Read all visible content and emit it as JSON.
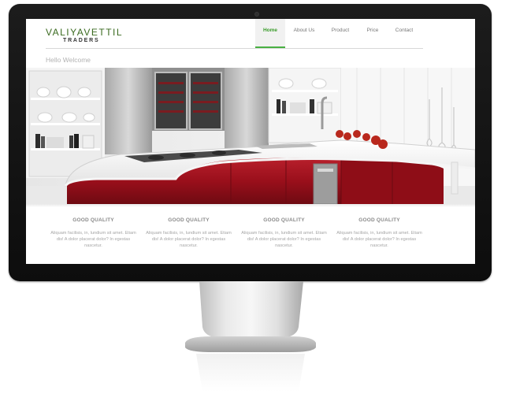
{
  "brand": {
    "name": "VALIYAVETTIL",
    "sub": "TRADERS"
  },
  "nav": {
    "items": [
      {
        "label": "Home",
        "active": true
      },
      {
        "label": "About Us",
        "active": false
      },
      {
        "label": "Product",
        "active": false
      },
      {
        "label": "Price",
        "active": false
      },
      {
        "label": "Contact",
        "active": false
      }
    ]
  },
  "welcome": "Hello Welcome",
  "features": [
    {
      "title": "GOOD QUALITY",
      "text": "Aliquam facilisis, in, lundium sit amet. Etiam dis! A dolor placerat dolor? In egestas nascetur."
    },
    {
      "title": "GOOD QUALITY",
      "text": "Aliquam facilisis, in, lundium sit amet. Etiam dis! A dolor placerat dolor? In egestas nascetur."
    },
    {
      "title": "GOOD QUALITY",
      "text": "Aliquam facilisis, in, lundium sit amet. Etiam dis! A dolor placerat dolor? In egestas nascetur."
    },
    {
      "title": "GOOD QUALITY",
      "text": "Aliquam facilisis, in, lundium sit amet. Etiam dis! A dolor placerat dolor? In egestas nascetur."
    }
  ],
  "colors": {
    "brand_green": "#3a6a1f",
    "nav_active": "#3a9c2a",
    "nav_underline": "#49b042",
    "kitchen_red": "#a5131f",
    "monitor_bezel": "#111111"
  }
}
